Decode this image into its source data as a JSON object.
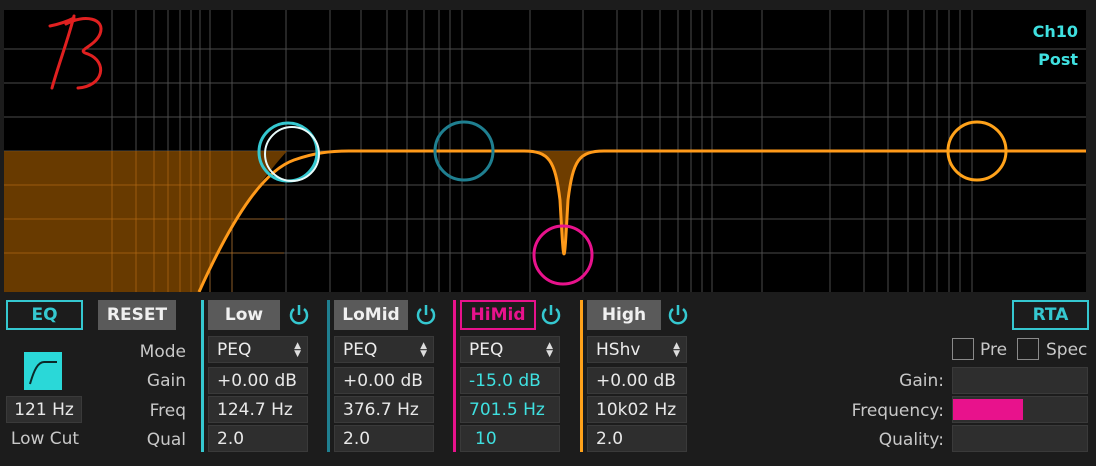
{
  "channel": {
    "name": "Ch10",
    "tap": "Post"
  },
  "colors": {
    "curve": "#ff9a1a",
    "low": "#35c8d0",
    "lomid": "#1f7f90",
    "himid": "#e8128c",
    "high": "#ffa21a",
    "accent": "#35c8d0"
  },
  "eq_button": "EQ",
  "reset_button": "RESET",
  "lowcut": {
    "freq": "121 Hz",
    "label": "Low Cut"
  },
  "row_labels": {
    "mode": "Mode",
    "gain": "Gain",
    "freq": "Freq",
    "qual": "Qual"
  },
  "bands": {
    "low": {
      "name": "Low",
      "mode": "PEQ",
      "gain": "+0.00 dB",
      "freq": "124.7 Hz",
      "q": "2.0"
    },
    "lomid": {
      "name": "LoMid",
      "mode": "PEQ",
      "gain": "+0.00 dB",
      "freq": "376.7 Hz",
      "q": "2.0"
    },
    "himid": {
      "name": "HiMid",
      "mode": "PEQ",
      "gain": "-15.0 dB",
      "freq": "701.5 Hz",
      "q": "10"
    },
    "high": {
      "name": "High",
      "mode": "HShv",
      "gain": "+0.00 dB",
      "freq": "10k02 Hz",
      "q": "2.0"
    }
  },
  "rta": {
    "button": "RTA",
    "pre": "Pre",
    "spec": "Spec",
    "gain_label": "Gain:",
    "frequency_label": "Frequency:",
    "quality_label": "Quality:",
    "frequency_level": 0.52
  }
}
